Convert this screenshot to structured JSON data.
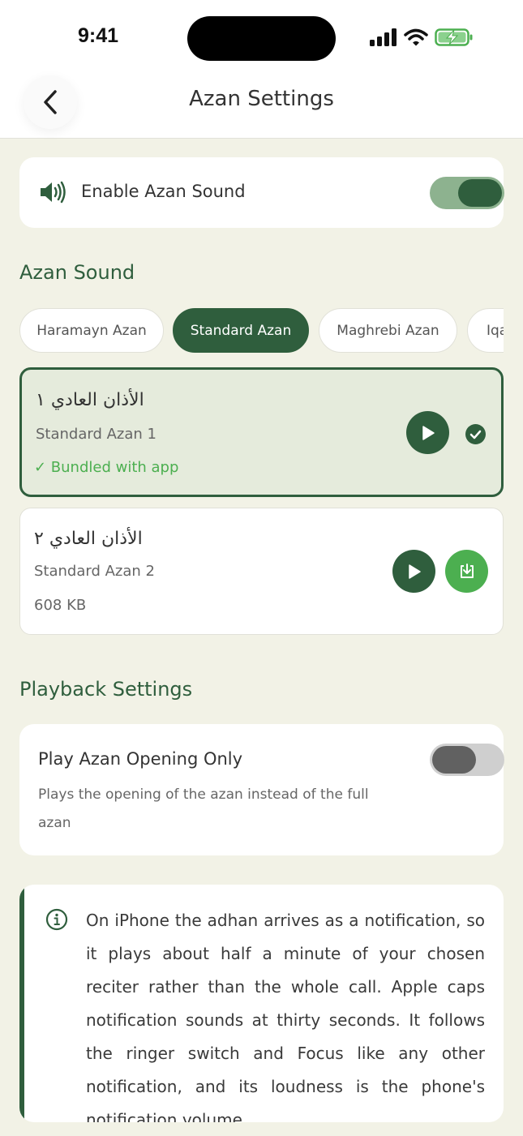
{
  "status_bar": {
    "time": "9:41"
  },
  "nav": {
    "title": "Azan Settings",
    "back_icon": "chevron-left-icon"
  },
  "enable": {
    "label": "Enable Azan Sound",
    "icon": "speaker-icon",
    "on": true
  },
  "azan_sound": {
    "title": "Azan Sound",
    "chips": [
      {
        "label": "Haramayn Azan",
        "active": false
      },
      {
        "label": "Standard Azan",
        "active": true
      },
      {
        "label": "Maghrebi Azan",
        "active": false
      },
      {
        "label": "Iqa",
        "active": false
      }
    ],
    "items": [
      {
        "arabic": "الأذان العادي ١",
        "name": "Standard Azan 1",
        "meta": "✓ Bundled with app",
        "selected": true
      },
      {
        "arabic": "الأذان العادي ٢",
        "name": "Standard Azan 2",
        "meta": "608 KB",
        "selected": false
      }
    ]
  },
  "playback": {
    "title": "Playback Settings",
    "opening_only": {
      "label": "Play Azan Opening Only",
      "description": "Plays the opening of the azan instead of the full azan",
      "on": false
    }
  },
  "info": {
    "icon": "info-icon",
    "text": "On iPhone the adhan arrives as a notification, so it plays about half a minute of your chosen reciter rather than the whole call. Apple caps notification sounds at thirty seconds. It follows the ringer switch and Focus like any other notification, and its loudness is the phone's notification volume."
  },
  "colors": {
    "accent": "#2f5e3d",
    "success": "#4caf50",
    "background": "#f2f2e6",
    "selected_card": "#e5ebdc"
  }
}
